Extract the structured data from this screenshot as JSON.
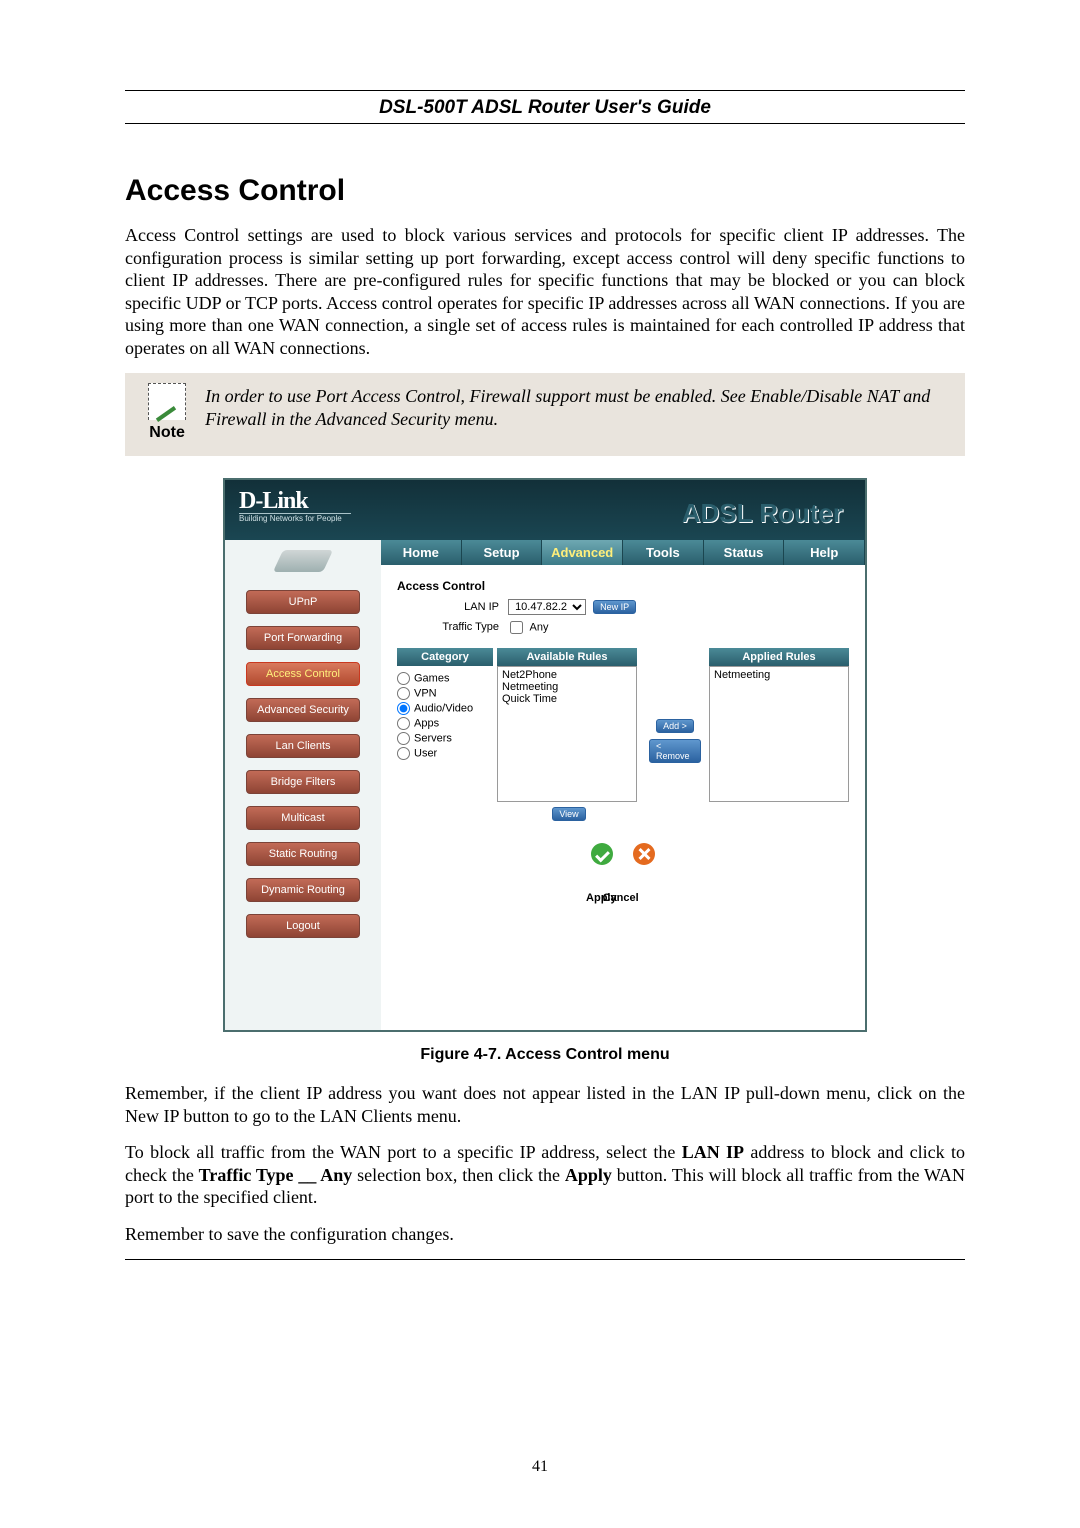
{
  "header": "DSL-500T ADSL Router User's Guide",
  "h1": "Access Control",
  "para1": "Access Control settings are used to block various services and protocols for specific client IP addresses. The configuration process is similar setting up port forwarding, except access control will deny specific functions to client IP addresses. There are pre-configured rules for specific functions that may be blocked or you can block specific UDP or TCP ports.  Access control operates for specific IP addresses across all WAN connections. If you are using more than one WAN connection, a single set of access rules is maintained for each controlled IP address that operates on all WAN connections.",
  "note_label": "Note",
  "note_text": "In order to use Port Access Control, Firewall support must be enabled. See Enable/Disable NAT and Firewall in the Advanced Security menu.",
  "router": {
    "brand": "D-Link",
    "tagline": "Building Networks for People",
    "title": "ADSL Router",
    "tabs": [
      "Home",
      "Setup",
      "Advanced",
      "Tools",
      "Status",
      "Help"
    ],
    "active_tab": "Advanced",
    "sidebar": [
      "UPnP",
      "Port Forwarding",
      "Access Control",
      "Advanced Security",
      "Lan Clients",
      "Bridge Filters",
      "Multicast",
      "Static Routing",
      "Dynamic Routing",
      "Logout"
    ],
    "sidebar_active": "Access Control",
    "section": "Access Control",
    "lan_ip_label": "LAN IP",
    "lan_ip_value": "10.47.82.2",
    "new_ip_btn": "New IP",
    "traffic_label": "Traffic Type",
    "traffic_value": "Any",
    "col_category": "Category",
    "col_available": "Available Rules",
    "col_applied": "Applied Rules",
    "categories": [
      "Games",
      "VPN",
      "Audio/Video",
      "Apps",
      "Servers",
      "User"
    ],
    "category_selected": "Audio/Video",
    "available": [
      "Net2Phone",
      "Netmeeting",
      "Quick Time"
    ],
    "applied": [
      "Netmeeting"
    ],
    "add_btn": "Add >",
    "remove_btn": "< Remove",
    "view_btn": "View",
    "apply": "Apply",
    "cancel": "Cancel"
  },
  "caption": "Figure 4-7. Access Control menu",
  "para2_pre": "Remember, if the client IP address you want does not appear listed in the LAN IP pull-down menu, click on the New IP button to go to the LAN Clients menu.",
  "para3_a": "To block all traffic from the WAN port to a specific IP address, select the ",
  "para3_b": "LAN IP",
  "para3_c": " address to block and click to check the ",
  "para3_d": "Traffic Type __ Any",
  "para3_e": " selection box, then click the ",
  "para3_f": "Apply",
  "para3_g": " button. This will block all traffic from the WAN port to the specified client.",
  "para4": "Remember to save the configuration changes.",
  "page_no": "41"
}
